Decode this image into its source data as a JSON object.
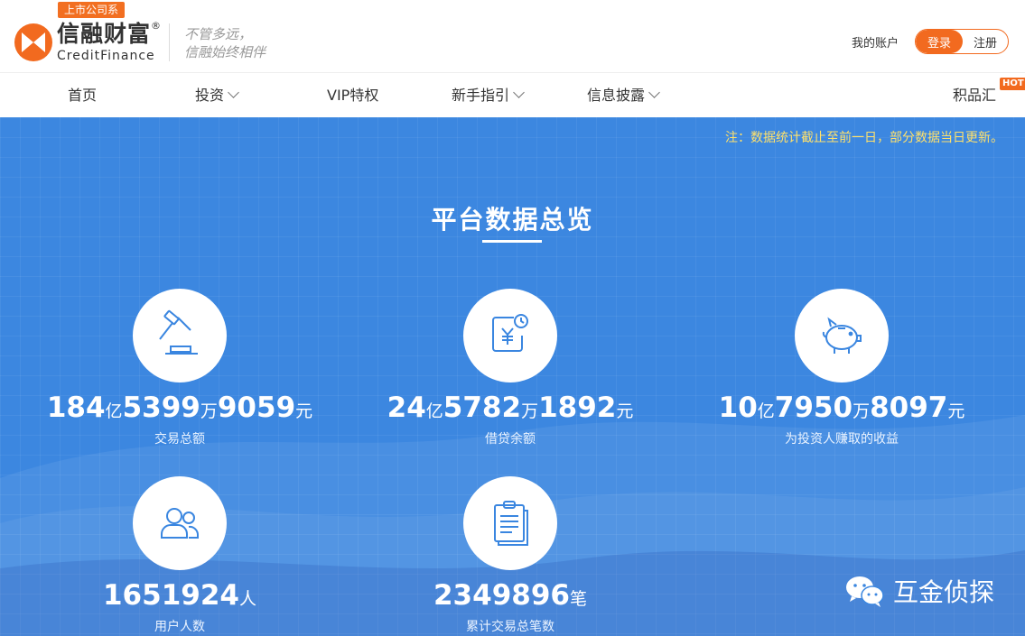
{
  "header": {
    "badge": "上市公司系",
    "brand_cn": "信融财富",
    "brand_reg": "®",
    "brand_en": "CreditFinance",
    "slogan_line1": "不管多远，",
    "slogan_line2": "信融始终相伴",
    "account": "我的账户",
    "login": "登录",
    "register": "注册",
    "accent": "#f26a1f"
  },
  "nav": {
    "items": [
      {
        "label": "首页"
      },
      {
        "label": "投资"
      },
      {
        "label": "VIP特权"
      },
      {
        "label": "新手指引"
      },
      {
        "label": "信息披露"
      },
      {
        "label": "积品汇"
      }
    ],
    "hot": "HOT"
  },
  "hero": {
    "note": "注：数据统计截止至前一日，部分数据当日更新。",
    "title": "平台数据总览",
    "background": "#3c87e0",
    "stats": [
      {
        "icon": "gavel-icon",
        "parts": [
          "184",
          "亿",
          "5399",
          "万",
          "9059",
          "元"
        ],
        "label": "交易总额"
      },
      {
        "icon": "loan-calendar-icon",
        "parts": [
          "24",
          "亿",
          "5782",
          "万",
          "1892",
          "元"
        ],
        "label": "借贷余额"
      },
      {
        "icon": "piggy-bank-icon",
        "parts": [
          "10",
          "亿",
          "7950",
          "万",
          "8097",
          "元"
        ],
        "label": "为投资人赚取的收益"
      },
      {
        "icon": "users-icon",
        "parts": [
          "1651924",
          "人"
        ],
        "label": "用户人数"
      },
      {
        "icon": "clipboard-icon",
        "parts": [
          "2349896",
          "笔"
        ],
        "label": "累计交易总笔数"
      }
    ]
  },
  "watermark": {
    "icon": "wechat-icon",
    "text": "互金侦探"
  }
}
